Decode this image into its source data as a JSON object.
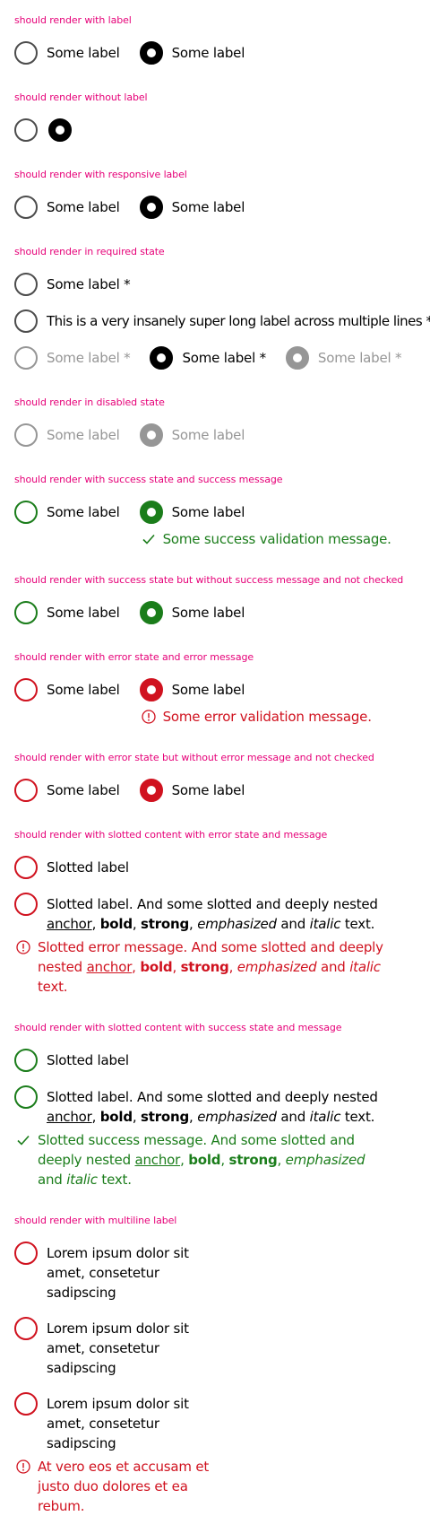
{
  "colors": {
    "section_title": "#e60078",
    "success": "#1b7d1b",
    "error": "#d0121f",
    "disabled": "#969696"
  },
  "icons": {
    "success": "checkmark-icon",
    "error": "exclamation-circle-icon"
  },
  "sections": {
    "with_label": {
      "title": "should render with label",
      "label": "Some label"
    },
    "without_label": {
      "title": "should render without label"
    },
    "responsive": {
      "title": "should render with responsive label",
      "label": "Some label"
    },
    "required": {
      "title": "should render in required state",
      "label": "Some label *",
      "long_label": "This is a very insanely super long label across multiple lines *"
    },
    "disabled": {
      "title": "should render in disabled state",
      "label": "Some label"
    },
    "success_msg": {
      "title": "should render with success state and success message",
      "label": "Some label",
      "message": "Some success validation message."
    },
    "success_nomsg": {
      "title": "should render with success state but without success message and not checked",
      "label": "Some label"
    },
    "error_msg": {
      "title": "should render with error state and error message",
      "label": "Some label",
      "message": "Some error validation message."
    },
    "error_nomsg": {
      "title": "should render with error state but without error message and not checked",
      "label": "Some label"
    },
    "slotted_error": {
      "title": "should render with slotted content with error state and message",
      "simple_label": "Slotted label",
      "rich_label": {
        "t1": "Slotted label. And some slotted and deeply nested ",
        "anchor": "anchor",
        "c1": ", ",
        "bold": "bold",
        "c2": ", ",
        "strong": "strong",
        "c3": ", ",
        "emphasized": "emphasized",
        "and": " and ",
        "italic": "italic",
        "end": " text."
      },
      "message": {
        "t1": "Slotted error message. And some slotted and deeply nested ",
        "anchor": "anchor",
        "c1": ", ",
        "bold": "bold",
        "c2": ", ",
        "strong": "strong",
        "c3": ", ",
        "emphasized": "emphasized",
        "and": " and ",
        "italic": "italic",
        "end": " text."
      }
    },
    "slotted_success": {
      "title": "should render with slotted content with success state and message",
      "simple_label": "Slotted label",
      "rich_label": {
        "t1": "Slotted label. And some slotted and deeply nested ",
        "anchor": "anchor",
        "c1": ", ",
        "bold": "bold",
        "c2": ", ",
        "strong": "strong",
        "c3": ", ",
        "emphasized": "emphasized",
        "and": " and ",
        "italic": "italic",
        "end": " text."
      },
      "message": {
        "t1": "Slotted success message. And some slotted and deeply nested ",
        "anchor": "anchor",
        "c1": ", ",
        "bold": "bold",
        "c2": ", ",
        "strong": "strong",
        "c3": ", ",
        "emphasized": "emphasized",
        "and": " and ",
        "italic": "italic",
        "end": " text."
      }
    },
    "multiline": {
      "title": "should render with multiline label",
      "label": "Lorem ipsum dolor sit amet, consetetur sadipscing",
      "message": "At vero eos et accusam et justo duo dolores et ea rebum."
    }
  }
}
